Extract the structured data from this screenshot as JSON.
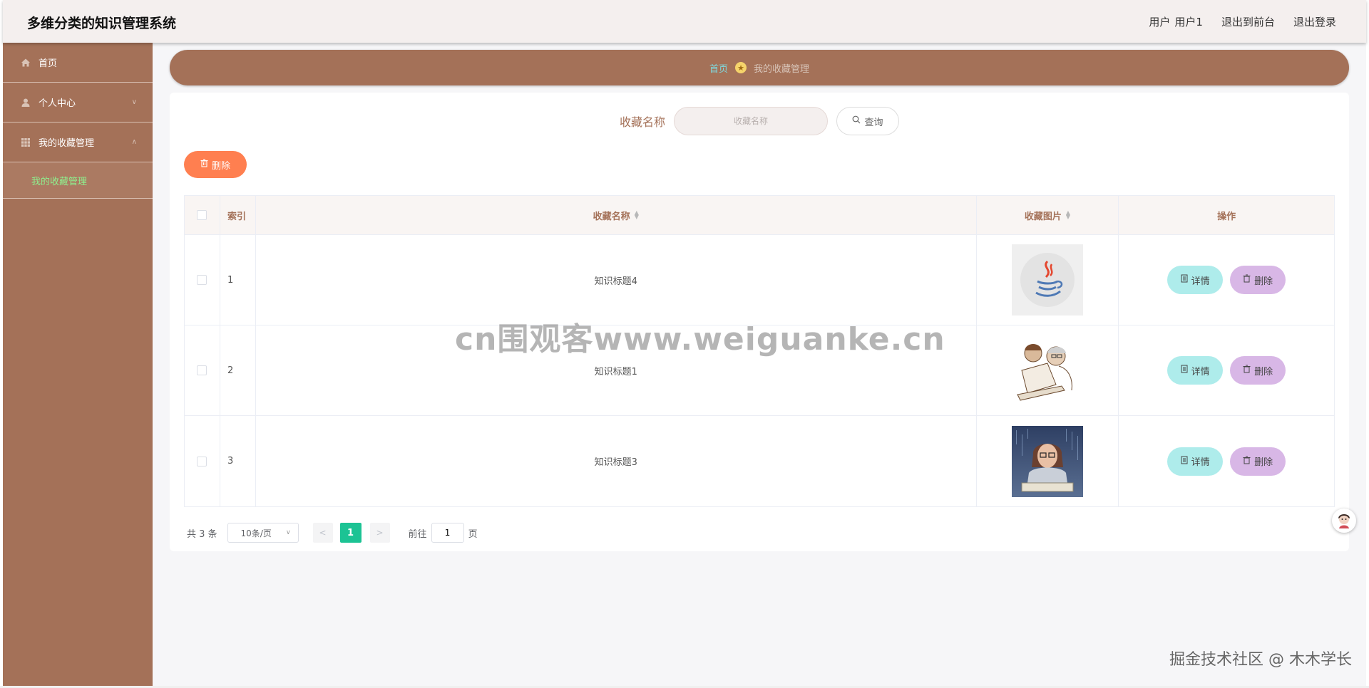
{
  "header": {
    "title": "多维分类的知识管理系统",
    "user_label": "用户",
    "user_name": "用户1",
    "to_front": "退出到前台",
    "logout": "退出登录"
  },
  "sidebar": {
    "items": [
      {
        "label": "首页",
        "icon": "home-icon"
      },
      {
        "label": "个人中心",
        "icon": "user-icon"
      },
      {
        "label": "我的收藏管理",
        "icon": "grid-icon"
      }
    ],
    "submenu": [
      "我的收藏管理"
    ]
  },
  "breadcrumb": {
    "home": "首页",
    "current": "我的收藏管理"
  },
  "search": {
    "label": "收藏名称",
    "placeholder": "收藏名称",
    "button": "查询"
  },
  "toolbar": {
    "delete": "删除"
  },
  "table": {
    "headers": {
      "index": "索引",
      "name": "收藏名称",
      "image": "收藏图片",
      "ops": "操作"
    },
    "rows": [
      {
        "index": "1",
        "name": "知识标题4",
        "image": "java-logo"
      },
      {
        "index": "2",
        "name": "知识标题1",
        "image": "sketch-programmers"
      },
      {
        "index": "3",
        "name": "知识标题3",
        "image": "girl-at-keyboard"
      }
    ],
    "op_detail": "详情",
    "op_delete": "删除"
  },
  "pagination": {
    "total": "共 3 条",
    "page_size": "10条/页",
    "current_page": "1",
    "goto_prefix": "前往",
    "goto_value": "1",
    "goto_suffix": "页"
  },
  "watermark": "cn围观客www.weiguanke.cn",
  "footer_mark": "掘金技术社区 @ 木木学长",
  "colors": {
    "brand": "#a47158",
    "header_bg": "#f4efee",
    "delete_btn": "#ff7f50",
    "detail_btn": "#aeeceb",
    "row_delete_btn": "#d8b7e6",
    "active_page": "#1cc394",
    "submenu_text": "#8ef08e"
  }
}
